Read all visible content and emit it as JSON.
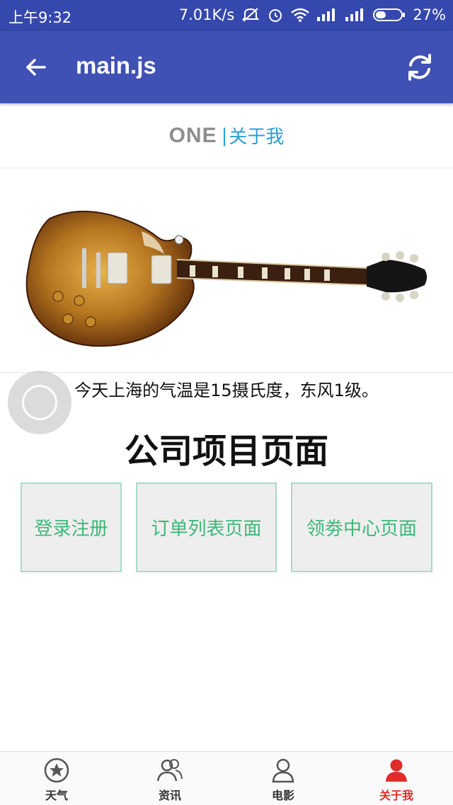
{
  "status_bar": {
    "time": "上午9:32",
    "net_speed": "7.01K/s",
    "battery": "27%"
  },
  "toolbar": {
    "title": "main.js",
    "back_icon": "arrow-left-icon",
    "refresh_icon": "refresh-icon"
  },
  "brand": {
    "logo": "ONE",
    "separator": "|",
    "label": "关于我"
  },
  "hero": {
    "image": "electric-guitar-image"
  },
  "weather_text": "今天上海的气温是15摄氏度，东风1级。",
  "section_title": "公司项目页面",
  "buttons": [
    {
      "label": "登录注册"
    },
    {
      "label": "订单列表页面"
    },
    {
      "label": "领劵中心页面"
    }
  ],
  "bottom_nav": [
    {
      "label": "天气",
      "icon": "star-circle-icon"
    },
    {
      "label": "资讯",
      "icon": "users-icon"
    },
    {
      "label": "电影",
      "icon": "user-outline-icon"
    },
    {
      "label": "关于我",
      "icon": "user-filled-icon",
      "active": true
    }
  ],
  "colors": {
    "primary": "#3f51b5",
    "accent_green": "#3cb878",
    "link_blue": "#2a9fd6",
    "active_red": "#e02b2b"
  }
}
